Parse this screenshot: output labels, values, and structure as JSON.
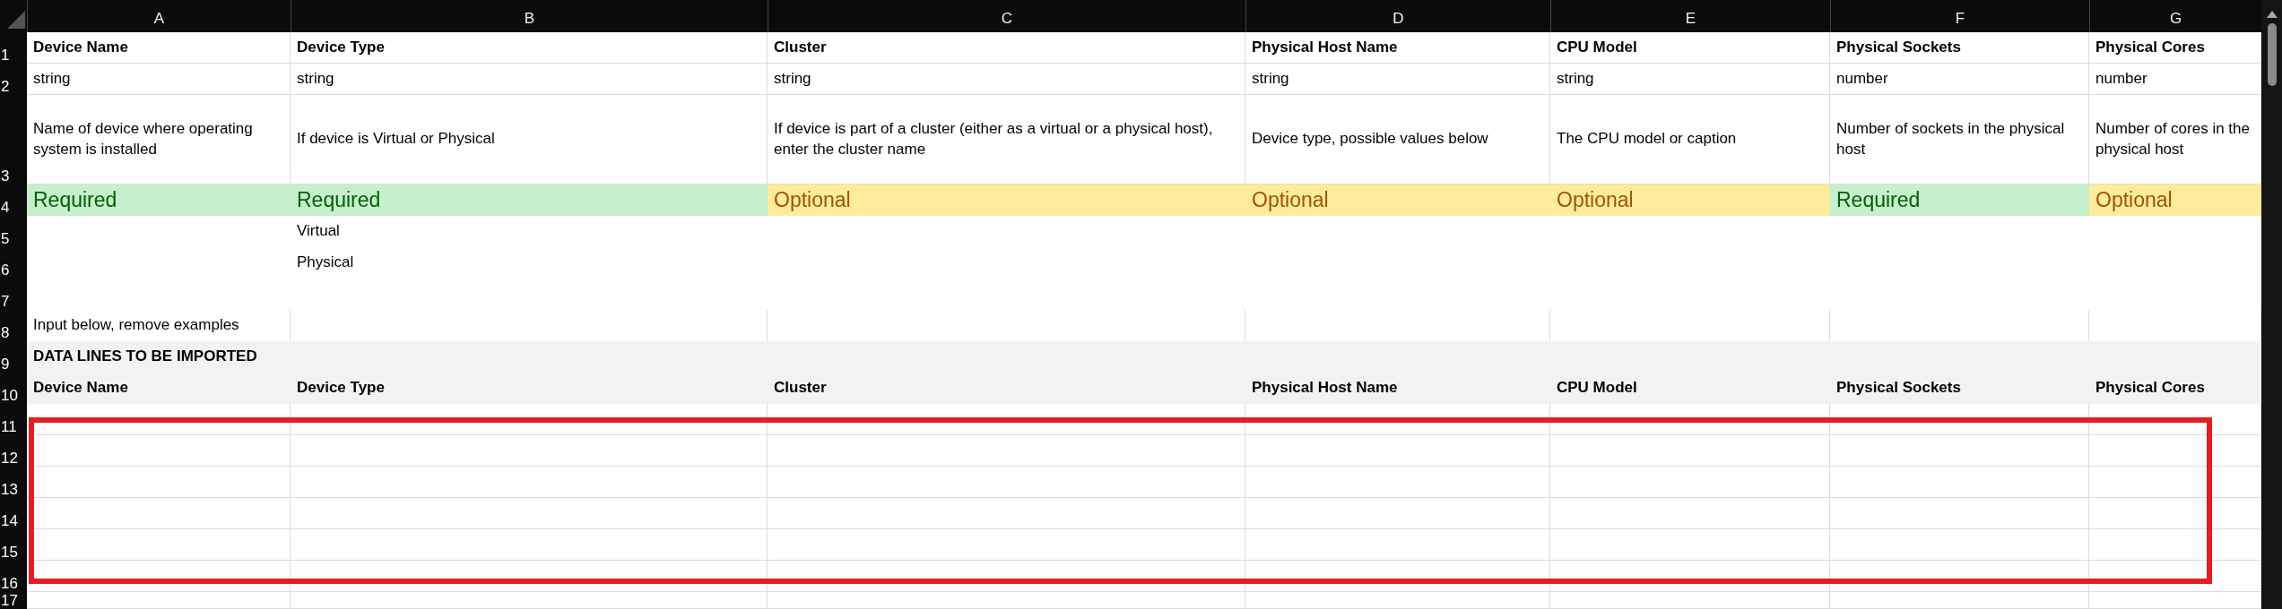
{
  "columns": [
    "A",
    "B",
    "C",
    "D",
    "E",
    "F",
    "G"
  ],
  "rows": [
    {
      "number": "1",
      "kind": "header",
      "cells": [
        {
          "text": "Device Name"
        },
        {
          "text": "Device Type"
        },
        {
          "text": "Cluster"
        },
        {
          "text": "Physical Host Name"
        },
        {
          "text": "CPU Model"
        },
        {
          "text": "Physical Sockets"
        },
        {
          "text": "Physical Cores"
        }
      ]
    },
    {
      "number": "2",
      "kind": "type",
      "cells": [
        {
          "text": "string"
        },
        {
          "text": "string"
        },
        {
          "text": "string"
        },
        {
          "text": "string"
        },
        {
          "text": "string"
        },
        {
          "text": "number"
        },
        {
          "text": "number"
        }
      ]
    },
    {
      "number": "3",
      "kind": "description",
      "cells": [
        {
          "text": "Name of device where operating system is installed"
        },
        {
          "text": "If device is Virtual or Physical"
        },
        {
          "text": "If device is part of a cluster (either as a virtual or a physical host), enter the cluster name"
        },
        {
          "text": "Device type, possible values below"
        },
        {
          "text": "The CPU model or caption"
        },
        {
          "text": "Number of sockets in the physical host"
        },
        {
          "text": "Number of cores in the physical host"
        }
      ]
    },
    {
      "number": "4",
      "kind": "requirement",
      "cells": [
        {
          "text": "Required",
          "required": true
        },
        {
          "text": "Required",
          "required": true
        },
        {
          "text": "Optional",
          "required": false
        },
        {
          "text": "Optional",
          "required": false
        },
        {
          "text": "Optional",
          "required": false
        },
        {
          "text": "Required",
          "required": true
        },
        {
          "text": "Optional",
          "required": false
        }
      ]
    },
    {
      "number": "5",
      "kind": "values",
      "cells": [
        null,
        {
          "text": "Virtual"
        }
      ]
    },
    {
      "number": "6",
      "kind": "values",
      "cells": [
        null,
        {
          "text": "Physical"
        }
      ]
    },
    {
      "number": "7",
      "kind": "values",
      "cells": []
    },
    {
      "number": "8",
      "kind": "note",
      "cells": [
        {
          "text": "Input below, remove examples"
        }
      ]
    },
    {
      "number": "9",
      "kind": "section",
      "cells": [
        {
          "text": "DATA LINES TO BE IMPORTED"
        }
      ]
    },
    {
      "number": "10",
      "kind": "subheader",
      "cells": [
        {
          "text": "Device Name"
        },
        {
          "text": "Device Type"
        },
        {
          "text": "Cluster"
        },
        {
          "text": "Physical Host Name"
        },
        {
          "text": "CPU Model"
        },
        {
          "text": "Physical Sockets"
        },
        {
          "text": "Physical Cores"
        }
      ]
    },
    {
      "number": "11",
      "kind": "entry",
      "cells": []
    },
    {
      "number": "12",
      "kind": "entry",
      "cells": []
    },
    {
      "number": "13",
      "kind": "entry",
      "cells": []
    },
    {
      "number": "14",
      "kind": "entry",
      "cells": []
    },
    {
      "number": "15",
      "kind": "entry",
      "cells": []
    },
    {
      "number": "16",
      "kind": "entry",
      "cells": []
    },
    {
      "number": "17",
      "kind": "entry",
      "cells": []
    }
  ]
}
